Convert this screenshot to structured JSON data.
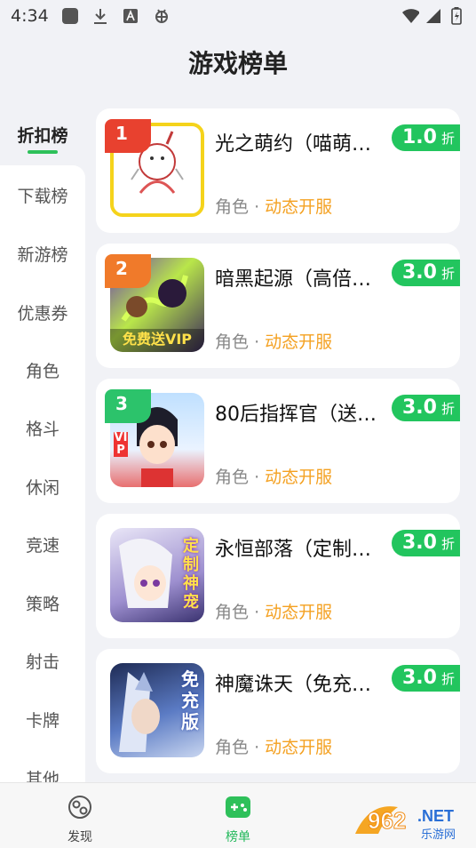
{
  "status": {
    "time": "4:34"
  },
  "page": {
    "title": "游戏榜单"
  },
  "sidebar": {
    "items": [
      {
        "label": "折扣榜"
      },
      {
        "label": "下载榜"
      },
      {
        "label": "新游榜"
      },
      {
        "label": "优惠券"
      },
      {
        "label": "角色"
      },
      {
        "label": "格斗"
      },
      {
        "label": "休闲"
      },
      {
        "label": "竞速"
      },
      {
        "label": "策略"
      },
      {
        "label": "射击"
      },
      {
        "label": "卡牌"
      },
      {
        "label": "其他"
      }
    ]
  },
  "games": [
    {
      "rank": "1",
      "name": "光之萌约（喵萌…",
      "discount": "1.0",
      "unit": "折",
      "category": "角色",
      "sep": "·",
      "tag": "动态开服"
    },
    {
      "rank": "2",
      "name": "暗黑起源（高倍…",
      "discount": "3.0",
      "unit": "折",
      "category": "角色",
      "sep": "·",
      "tag": "动态开服"
    },
    {
      "rank": "3",
      "name": "80后指挥官（送…",
      "discount": "3.0",
      "unit": "折",
      "category": "角色",
      "sep": "·",
      "tag": "动态开服"
    },
    {
      "rank": "",
      "name": "永恒部落（定制…",
      "discount": "3.0",
      "unit": "折",
      "category": "角色",
      "sep": "·",
      "tag": "动态开服"
    },
    {
      "rank": "",
      "name": "神魔诛天（免充…",
      "discount": "3.0",
      "unit": "折",
      "category": "角色",
      "sep": "·",
      "tag": "动态开服"
    }
  ],
  "thumb_text": {
    "g2": "免费送VIP",
    "g3": "VIP",
    "g4": "定制神宠",
    "g5": "免充版"
  },
  "tabs": [
    {
      "label": "发现"
    },
    {
      "label": "榜单"
    }
  ],
  "watermark": {
    "logo": "962",
    "domain": ".NET",
    "sub": "乐游网"
  },
  "colors": {
    "accent": "#22c55e",
    "tag": "#f4a122",
    "rank1": "#e8412f",
    "rank2": "#f07a2a",
    "rank3": "#2cc36b"
  }
}
